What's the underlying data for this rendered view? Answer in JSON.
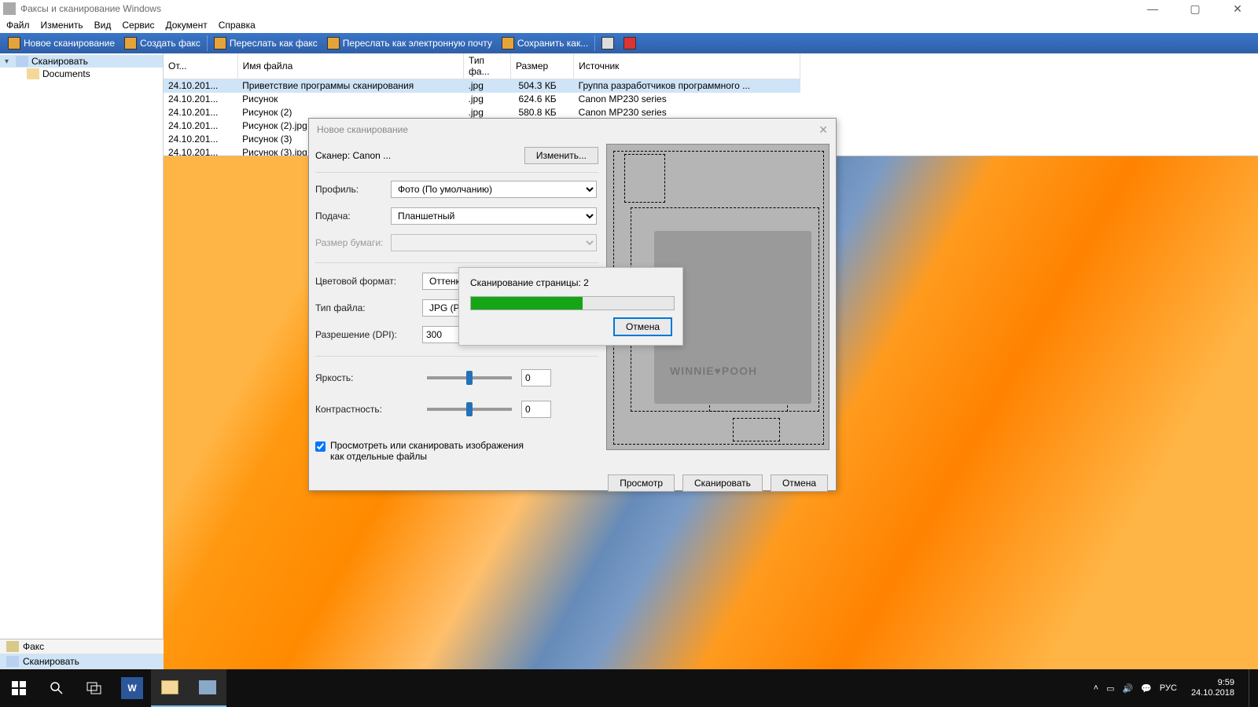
{
  "window": {
    "title": "Факсы и сканирование Windows"
  },
  "menu": {
    "file": "Файл",
    "edit": "Изменить",
    "view": "Вид",
    "tools": "Сервис",
    "document": "Документ",
    "help": "Справка"
  },
  "toolbar": {
    "new_scan": "Новое сканирование",
    "create_fax": "Создать факс",
    "forward_fax": "Переслать как факс",
    "forward_email": "Переслать как электронную почту",
    "save_as": "Сохранить как..."
  },
  "tree": {
    "root": "Сканировать",
    "child": "Documents"
  },
  "modes": {
    "fax": "Факс",
    "scan": "Сканировать"
  },
  "columns": {
    "date": "От...",
    "name": "Имя файла",
    "type": "Тип фа...",
    "size": "Размер",
    "source": "Источник"
  },
  "files": [
    {
      "date": "24.10.201...",
      "name": "Приветствие программы сканирования",
      "type": ".jpg",
      "size": "504.3 КБ",
      "source": "Группа разработчиков программного ..."
    },
    {
      "date": "24.10.201...",
      "name": "Рисунок",
      "type": ".jpg",
      "size": "624.6 КБ",
      "source": "Canon MP230 series"
    },
    {
      "date": "24.10.201...",
      "name": "Рисунок (2)",
      "type": ".jpg",
      "size": "580.8 КБ",
      "source": "Canon MP230 series"
    },
    {
      "date": "24.10.201...",
      "name": "Рисунок (2).jpg",
      "type": "",
      "size": "",
      "source": ""
    },
    {
      "date": "24.10.201...",
      "name": "Рисунок (3)",
      "type": "",
      "size": "",
      "source": ""
    },
    {
      "date": "24.10.201...",
      "name": "Рисунок (3).jpg",
      "type": "",
      "size": "",
      "source": ""
    }
  ],
  "dialog": {
    "title": "Новое сканирование",
    "scanner_label": "Сканер: Canon ...",
    "change": "Изменить...",
    "profile_label": "Профиль:",
    "profile_value": "Фото (По умолчанию)",
    "source_label": "Подача:",
    "source_value": "Планшетный",
    "paper_label": "Размер бумаги:",
    "color_label": "Цветовой формат:",
    "color_value": "Оттенки",
    "filetype_label": "Тип файла:",
    "filetype_value": "JPG (Рис",
    "dpi_label": "Разрешение (DPI):",
    "dpi_value": "300",
    "brightness_label": "Яркость:",
    "brightness_value": "0",
    "contrast_label": "Контрастность:",
    "contrast_value": "0",
    "separate_files": "Просмотреть или сканировать изображения как отдельные файлы",
    "btn_preview": "Просмотр",
    "btn_scan": "Сканировать",
    "btn_cancel": "Отмена"
  },
  "progress": {
    "text": "Сканирование страницы: 2",
    "cancel": "Отмена",
    "percent": 55
  },
  "taskbar": {
    "lang": "РУС",
    "time": "9:59",
    "date": "24.10.2018"
  }
}
